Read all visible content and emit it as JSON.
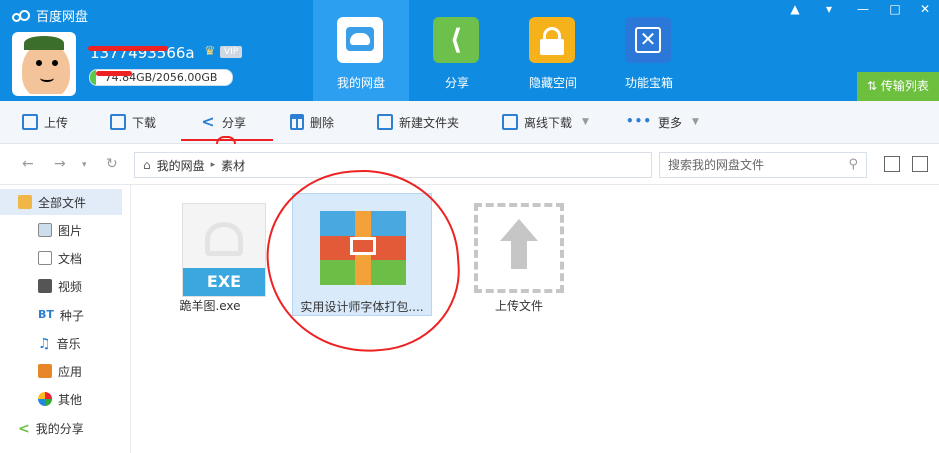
{
  "app": {
    "title": "百度网盘"
  },
  "user": {
    "name": "1​3774​93566a",
    "vip_tag": "VIP",
    "quota_text": "74.​84GB/2056.00GB",
    "quota_used_fraction": 0.04
  },
  "nav_tabs": [
    {
      "label": "我的网盘",
      "icon": "cloud-icon",
      "active": true
    },
    {
      "label": "分享",
      "icon": "share-icon",
      "active": false
    },
    {
      "label": "隐藏空间",
      "icon": "lock-icon",
      "active": false
    },
    {
      "label": "功能宝箱",
      "icon": "toolbox-icon",
      "active": false
    }
  ],
  "window_controls": [
    "bell-icon",
    "dropdown-icon",
    "minimize-icon",
    "maximize-icon",
    "close-icon"
  ],
  "transfer_list": {
    "label": "传输列表"
  },
  "toolbar": {
    "upload": "上传",
    "download": "下载",
    "share": "分享",
    "delete": "删除",
    "new_folder": "新建文件夹",
    "offline_download": "离线下载",
    "more": "更多"
  },
  "address": {
    "crumbs": [
      "我的网盘",
      "素材"
    ],
    "search_placeholder": "搜索我的网盘文件"
  },
  "sidebar": {
    "items": [
      {
        "label": "全部文件",
        "icon": "folder-icon",
        "active": true
      },
      {
        "label": "图片",
        "icon": "image-icon"
      },
      {
        "label": "文档",
        "icon": "document-icon"
      },
      {
        "label": "视频",
        "icon": "video-icon"
      },
      {
        "label": "种子",
        "icon": "bt-icon"
      },
      {
        "label": "音乐",
        "icon": "music-icon"
      },
      {
        "label": "应用",
        "icon": "app-icon"
      },
      {
        "label": "其他",
        "icon": "other-icon"
      },
      {
        "label": "我的分享",
        "icon": "share-icon"
      }
    ]
  },
  "files": [
    {
      "name": "跪羊图.exe",
      "badge": "EXE"
    },
    {
      "name": "实用设计师字体打包...."
    },
    {
      "name": "上传文件"
    }
  ],
  "colors": {
    "header_blue": "#0f8ce2",
    "active_tab": "#2c9ff0",
    "transfer_green": "#6dbf3e",
    "annotation_red": "#e22222"
  }
}
